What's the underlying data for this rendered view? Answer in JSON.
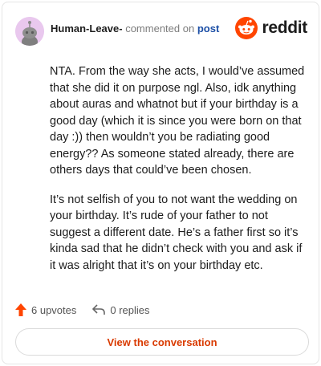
{
  "header": {
    "author": "Human-Leave-",
    "action": "commented on",
    "post_link": "post",
    "brand": "reddit"
  },
  "comment": {
    "paragraphs": [
      "NTA. From the way she acts, I would’ve assumed that she did it on purpose ngl. Also, idk anything about auras and whatnot but if your birthday is a good day (which it is since you were born on that day :)) then wouldn’t you be radiating good energy?? As someone stated already, there are others days that could’ve been chosen.",
      "It’s not selfish of you to not want the wedding on your birthday. It’s rude of your father to not suggest a different date. He’s a father first so it’s kinda sad that he didn’t check with you and ask if it was alright that it’s on your birthday etc."
    ]
  },
  "footer": {
    "upvotes": "6 upvotes",
    "replies": "0 replies",
    "cta": "View the conversation"
  },
  "colors": {
    "brand_orange": "#ff4500",
    "link_blue": "#1c4fa6",
    "cta_text": "#d93a00",
    "avatar_bg": "#e9c8ee"
  },
  "icons": {
    "avatar": "snoo-avatar-icon",
    "brand": "reddit-snoo-icon",
    "upvote": "upvote-arrow-icon",
    "reply": "reply-arrow-icon"
  }
}
